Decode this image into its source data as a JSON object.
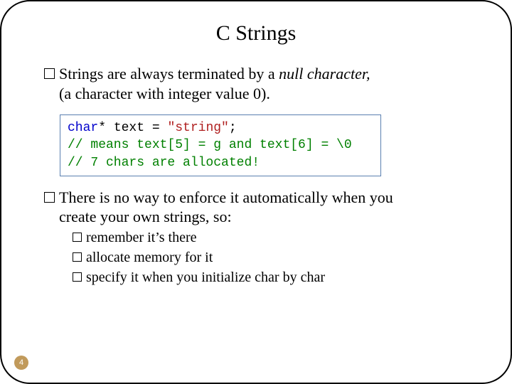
{
  "title": "C Strings",
  "bullet1": {
    "line1_pre": "Strings are always terminated by a ",
    "line1_em": "null character,",
    "line2": "(a character with integer value 0)."
  },
  "code": {
    "l1_kw": "char",
    "l1_rest": "* text = ",
    "l1_str": "\"string\"",
    "l1_semi": ";",
    "l2": "// means text[5] = g and text[6] = \\0",
    "l3": "// 7 chars are allocated!"
  },
  "bullet2": {
    "line1": "There is no way to enforce it automatically when you",
    "line2": "create your own strings, so:"
  },
  "sub": {
    "a": "remember it’s there",
    "b": "allocate memory for it",
    "c": "specify it when you initialize char by char"
  },
  "page": "4"
}
